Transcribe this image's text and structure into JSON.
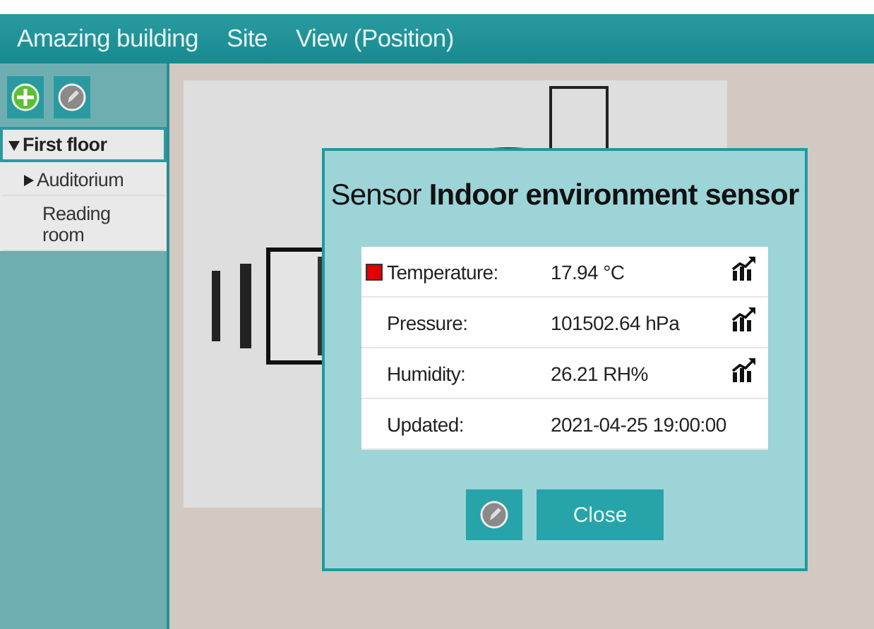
{
  "menu": [
    {
      "label": "Amazing building"
    },
    {
      "label": "Site"
    },
    {
      "label": "View (Position)"
    }
  ],
  "toolbar": [
    {
      "kind": "add"
    },
    {
      "kind": "edit"
    }
  ],
  "tree": [
    {
      "label": "First floor",
      "selected": true,
      "expanded": true,
      "leaf": false,
      "children": [
        {
          "label": "Auditorium",
          "selected": false,
          "expanded": false,
          "leaf": false
        },
        {
          "label": "Reading room",
          "selected": false,
          "leaf": true
        }
      ]
    }
  ],
  "dialog": {
    "title": "Sensor **Indoor environment sensor**",
    "rows": [
      {
        "label": "Temperature:",
        "value": "17.94 °C",
        "alarm": true,
        "chart": true
      },
      {
        "label": "Pressure:",
        "value": "101502.64 hPa",
        "alarm": false,
        "chart": true
      },
      {
        "label": "Humidity:",
        "value": "26.21 RH%",
        "alarm": false,
        "chart": true
      },
      {
        "label": "Updated:",
        "value": "2021-04-25 19:00:00",
        "alarm": false,
        "chart": false
      }
    ],
    "close": "Close"
  }
}
